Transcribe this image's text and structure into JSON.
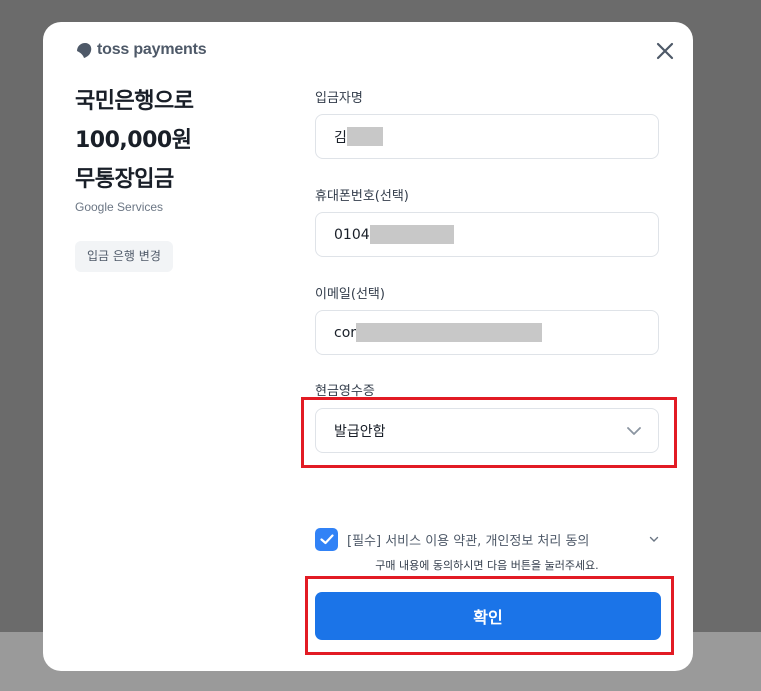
{
  "brand": {
    "logo_text": "toss payments"
  },
  "summary": {
    "title_lines": [
      "국민은행으로",
      "100,000원",
      "무통장입금"
    ],
    "merchant": "Google Services",
    "change_bank_label": "입금 은행 변경"
  },
  "form": {
    "depositor_label": "입금자명",
    "depositor_value": "김",
    "phone_label": "휴대폰번호(선택)",
    "phone_value": "0104",
    "email_label": "이메일(선택)",
    "email_value": "cor",
    "receipt_label": "현금영수증",
    "receipt_selected": "발급안함"
  },
  "agreement": {
    "checked": true,
    "text": "[필수] 서비스 이용 약관, 개인정보 처리 동의",
    "hint": "구매 내용에 동의하시면 다음 버튼을 눌러주세요."
  },
  "actions": {
    "confirm_label": "확인"
  },
  "colors": {
    "accent": "#3182f6",
    "button": "#1b74e8",
    "highlight": "#e21b24"
  }
}
